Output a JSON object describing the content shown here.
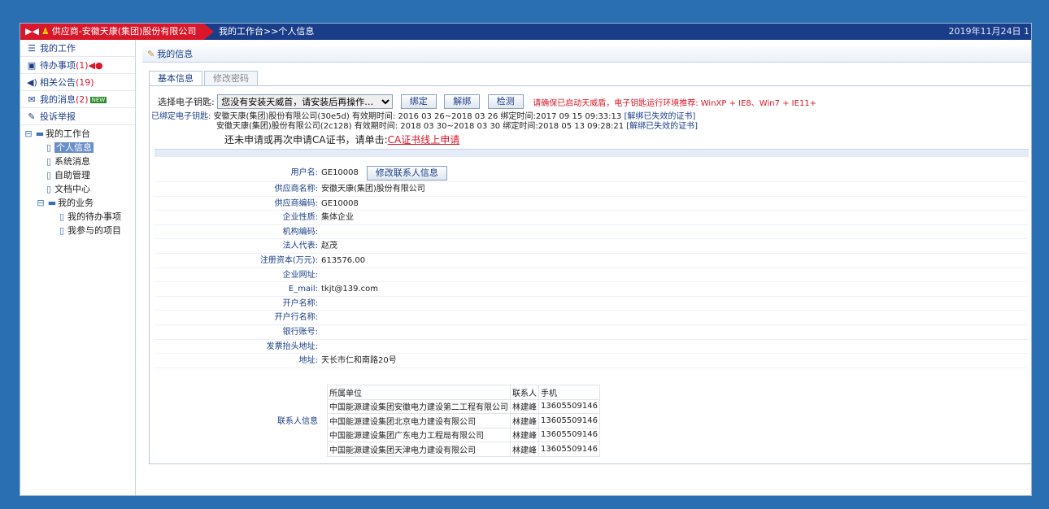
{
  "topbar": {
    "supplier": "供应商-安徽天康(集团)股份有限公司",
    "crumb": "我的工作台>>个人信息",
    "date": "2019年11月24日 1"
  },
  "sidebar": {
    "items": [
      {
        "label": "我的工作",
        "icon": "work-icon"
      },
      {
        "label": "待办事项",
        "count": "(1)",
        "icon": "inbox-icon"
      },
      {
        "label": "相关公告",
        "count": "(19)",
        "icon": "speaker-icon"
      },
      {
        "label": "我的消息",
        "count": "(2)",
        "badge": "NEW",
        "icon": "mail-icon"
      },
      {
        "label": "投诉举报",
        "icon": "complaint-icon"
      }
    ],
    "tree": {
      "root": "我的工作台",
      "nodes": [
        "个人信息",
        "系统消息",
        "自助管理",
        "文档中心"
      ],
      "sub_root": "我的业务",
      "sub_nodes": [
        "我的待办事项",
        "我参与的项目"
      ]
    }
  },
  "main": {
    "title": "我的信息",
    "tabs": [
      "基本信息",
      "修改密码"
    ],
    "cert_select_label": "选择电子钥匙:",
    "cert_select_value": "您没有安装天威首，请安装后再操作…",
    "btn_bind": "绑定",
    "btn_unbind": "解绑",
    "btn_check": "检测",
    "warning": "请确保已启动天威盾，电子钥匙运行环境推荐: WinXP + IE8、Win7 + IE11+",
    "bound_label": "已绑定电子钥匙:",
    "bound_lines": [
      {
        "text": "安徽天康(集团)股份有限公司(30e5d) 有效期时间: 2016 03 26~2018 03 26  绑定时间:2017 09 15 09:33:13",
        "link": "[解绑已失效的证书]"
      },
      {
        "text": "安徽天康(集团)股份有限公司(2c128) 有效期时间: 2018 03 30~2018 03 30  绑定时间:2018 05 13 09:28:21",
        "link": "[解绑已失效的证书]"
      }
    ],
    "apply_text": "还未申请或再次申请CA证书，请单击:",
    "apply_link": "CA证书线上申请"
  },
  "info": {
    "account_label": "用户名:",
    "account": "GE10008",
    "btn_modify": "修改联系人信息",
    "supplier_name_label": "供应商名称:",
    "supplier_name": "安徽天康(集团)股份有限公司",
    "supplier_code_label": "供应商编码:",
    "supplier_code": "GE10008",
    "enterprise_type_label": "企业性质:",
    "enterprise_type": "集体企业",
    "org_code_label": "机构编码:",
    "legal_label": "法人代表:",
    "legal": "赵茂",
    "capital_label": "注册资本(万元):",
    "capital": "613576.00",
    "website_label": "企业网址:",
    "email_label": "E_mail:",
    "email": "tkjt@139.com",
    "bank_label": "开户名称:",
    "bank_branch_label": "开户行名称:",
    "account_no_label": "银行账号:",
    "invoice_label": "发票抬头地址:",
    "address_label": "地址:",
    "address": "天长市仁和南路20号"
  },
  "contacts": {
    "label": "联系人信息",
    "headers": [
      "所属单位",
      "联系人",
      "手机"
    ],
    "rows": [
      [
        "中国能源建设集团安徽电力建设第二工程有限公司",
        "林建峰",
        "13605509146"
      ],
      [
        "中国能源建设集团北京电力建设有限公司",
        "林建峰",
        "13605509146"
      ],
      [
        "中国能源建设集团广东电力工程局有限公司",
        "林建峰",
        "13605509146"
      ],
      [
        "中国能源建设集团天津电力建设有限公司",
        "林建峰",
        "13605509146"
      ]
    ]
  }
}
